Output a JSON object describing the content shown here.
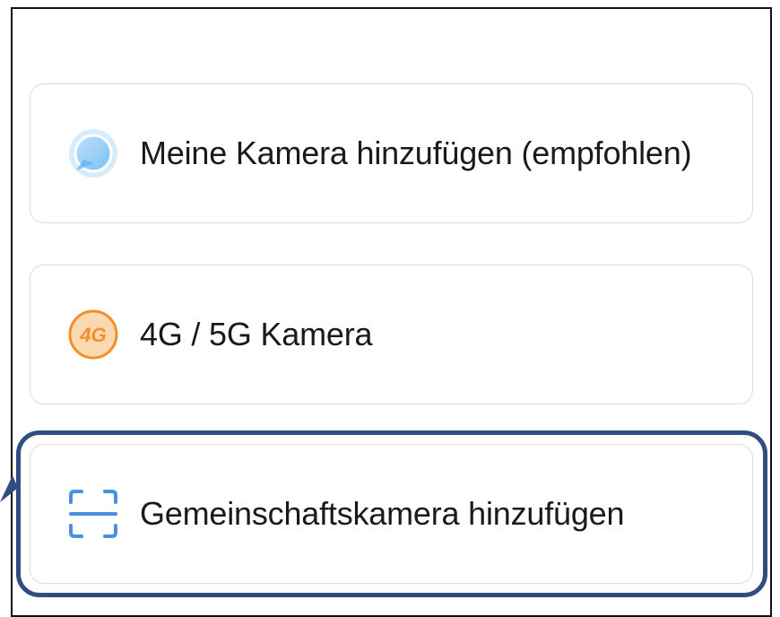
{
  "options": [
    {
      "label": "Meine Kamera hinzufügen (empfohlen)",
      "icon": "camera-lens-icon",
      "icon_color": "#5aaef0"
    },
    {
      "label": "4G / 5G Kamera",
      "icon": "4g-badge-icon",
      "icon_text": "4G",
      "icon_color": "#f0902a"
    },
    {
      "label": "Gemeinschaftskamera hinzufügen",
      "icon": "scan-frame-icon",
      "icon_color": "#4a90e2"
    }
  ],
  "highlight": {
    "color": "#2f4e7f"
  }
}
